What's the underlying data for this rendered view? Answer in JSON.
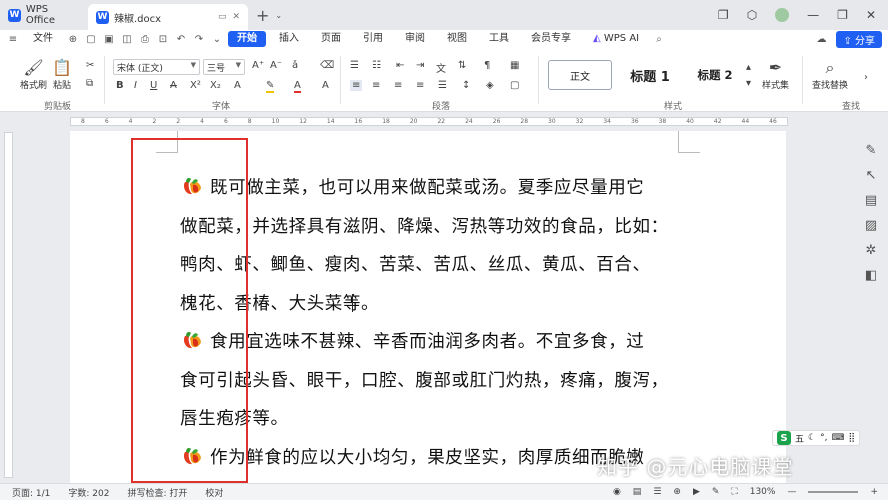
{
  "titlebar": {
    "app_tab": "WPS Office",
    "doc_tab": "辣椒.docx"
  },
  "menubar": {
    "file": "文件",
    "tabs": [
      "开始",
      "插入",
      "页面",
      "引用",
      "审阅",
      "视图",
      "工具",
      "会员专享"
    ],
    "ai": "WPS AI",
    "share": "分享"
  },
  "ribbon": {
    "format_painter": "格式刷",
    "paste": "粘贴",
    "font_name": "宋体 (正文)",
    "font_size": "三号",
    "style_normal": "正文",
    "style_h1": "标题 1",
    "style_h2": "标题 2",
    "style_set": "样式集",
    "find_replace": "查找替换",
    "groups": {
      "clipboard": "剪贴板",
      "font": "字体",
      "paragraph": "段落",
      "styles": "样式",
      "find": "查找"
    }
  },
  "document": {
    "paragraphs": [
      {
        "lines": [
          "既可做主菜，也可以用来做配菜或汤。夏季应尽量用它",
          "做配菜，并选择具有滋阴、降燥、泻热等功效的食品，比如：",
          "鸭肉、虾、鲫鱼、瘦肉、苦菜、苦瓜、丝瓜、黄瓜、百合、",
          "槐花、香椿、大头菜等。"
        ]
      },
      {
        "lines": [
          "食用宜选味不甚辣、辛香而油润多肉者。不宜多食，过",
          "食可引起头昏、眼干，口腔、腹部或肛门灼热，疼痛，腹泻，",
          "唇生疱疹等。"
        ]
      },
      {
        "lines": [
          "作为鲜食的应以大小均匀，果皮坚实，肉厚质细而脆嫩"
        ]
      }
    ]
  },
  "ime": {
    "label": "五"
  },
  "watermark": "知乎 @元心电脑课堂",
  "status": {
    "page": "页面: 1/1",
    "words": "字数: 202",
    "spell": "拼写检查: 打开",
    "proof": "校对",
    "zoom": "130%"
  },
  "colors": {
    "accent": "#1f5ff2",
    "highlight_box": "#e0302c"
  }
}
